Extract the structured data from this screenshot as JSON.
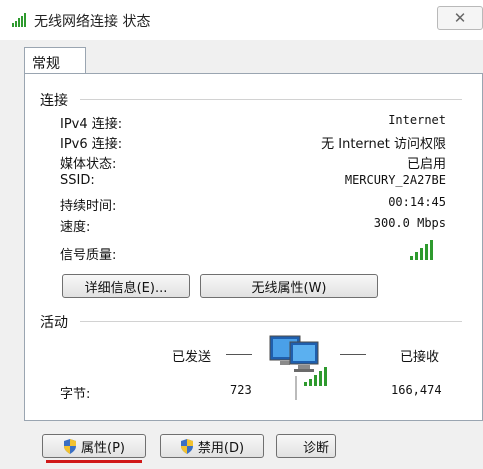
{
  "window": {
    "title": "无线网络连接 状态"
  },
  "tabs": [
    {
      "label": "常规"
    }
  ],
  "connection": {
    "group_label": "连接",
    "rows": [
      {
        "key": "IPv4 连接:",
        "value": "Internet"
      },
      {
        "key": "IPv6 连接:",
        "value": "无 Internet 访问权限"
      },
      {
        "key": "媒体状态:",
        "value": "已启用"
      },
      {
        "key": "SSID:",
        "value": "MERCURY_2A27BE"
      },
      {
        "key": "持续时间:",
        "value": "00:14:45"
      },
      {
        "key": "速度:",
        "value": "300.0 Mbps"
      }
    ],
    "signal_label": "信号质量:",
    "signal_bars": 5,
    "signal_max": 5,
    "details_button": "详细信息(E)...",
    "wireless_props_button": "无线属性(W)"
  },
  "activity": {
    "group_label": "活动",
    "sent_label": "已发送",
    "received_label": "已接收",
    "bytes_label": "字节:",
    "bytes_sent": "723",
    "bytes_received": "166,474"
  },
  "bottom_buttons": {
    "properties": "属性(P)",
    "disable": "禁用(D)",
    "diagnose": "诊断"
  },
  "colors": {
    "signal": "#2e9a2e",
    "highlight": "#d01818",
    "uac_shield": "#3a6fc4"
  },
  "icons": [
    "wifi-signal-icon",
    "close-icon",
    "network-computers-icon",
    "uac-shield-icon"
  ]
}
